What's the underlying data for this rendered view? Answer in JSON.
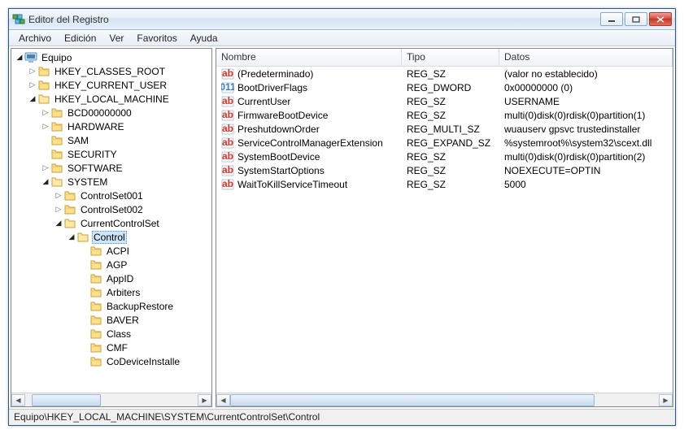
{
  "window": {
    "title": "Editor del Registro"
  },
  "menubar": [
    "Archivo",
    "Edición",
    "Ver",
    "Favoritos",
    "Ayuda"
  ],
  "tree": {
    "root": "Equipo",
    "hives": [
      "HKEY_CLASSES_ROOT",
      "HKEY_CURRENT_USER",
      "HKEY_LOCAL_MACHINE"
    ],
    "hklm_children": [
      "BCD00000000",
      "HARDWARE",
      "SAM",
      "SECURITY",
      "SOFTWARE",
      "SYSTEM"
    ],
    "system_children": [
      "ControlSet001",
      "ControlSet002",
      "CurrentControlSet"
    ],
    "ccs_children": [
      "Control"
    ],
    "control_children": [
      "ACPI",
      "AGP",
      "AppID",
      "Arbiters",
      "BackupRestore",
      "BAVER",
      "Class",
      "CMF",
      "CoDeviceInstalle"
    ]
  },
  "list": {
    "headers": {
      "nombre": "Nombre",
      "tipo": "Tipo",
      "datos": "Datos"
    },
    "rows": [
      {
        "icon": "str",
        "name": "(Predeterminado)",
        "type": "REG_SZ",
        "data": "(valor no establecido)"
      },
      {
        "icon": "bin",
        "name": "BootDriverFlags",
        "type": "REG_DWORD",
        "data": "0x00000000 (0)"
      },
      {
        "icon": "str",
        "name": "CurrentUser",
        "type": "REG_SZ",
        "data": "USERNAME"
      },
      {
        "icon": "str",
        "name": "FirmwareBootDevice",
        "type": "REG_SZ",
        "data": "multi(0)disk(0)rdisk(0)partition(1)"
      },
      {
        "icon": "str",
        "name": "PreshutdownOrder",
        "type": "REG_MULTI_SZ",
        "data": "wuauserv gpsvc trustedinstaller"
      },
      {
        "icon": "str",
        "name": "ServiceControlManagerExtension",
        "type": "REG_EXPAND_SZ",
        "data": "%systemroot%\\system32\\scext.dll"
      },
      {
        "icon": "str",
        "name": "SystemBootDevice",
        "type": "REG_SZ",
        "data": "multi(0)disk(0)rdisk(0)partition(2)"
      },
      {
        "icon": "str",
        "name": "SystemStartOptions",
        "type": "REG_SZ",
        "data": " NOEXECUTE=OPTIN"
      },
      {
        "icon": "str",
        "name": "WaitToKillServiceTimeout",
        "type": "REG_SZ",
        "data": "5000"
      }
    ]
  },
  "statusbar": "Equipo\\HKEY_LOCAL_MACHINE\\SYSTEM\\CurrentControlSet\\Control"
}
